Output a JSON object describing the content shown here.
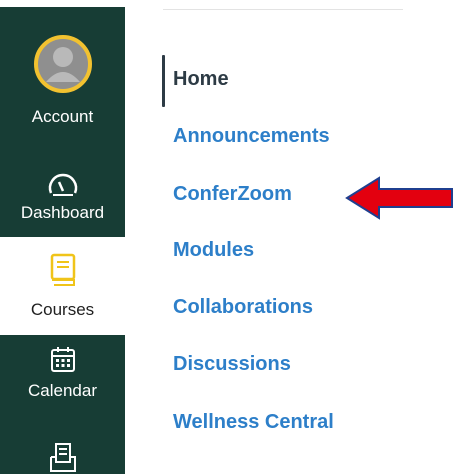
{
  "global_nav": {
    "account": {
      "label": "Account",
      "icon": "avatar-icon"
    },
    "dashboard": {
      "label": "Dashboard",
      "icon": "speedometer-icon"
    },
    "courses": {
      "label": "Courses",
      "icon": "book-icon"
    },
    "calendar": {
      "label": "Calendar",
      "icon": "calendar-icon"
    },
    "inbox": {
      "icon": "inbox-icon"
    }
  },
  "course_nav": {
    "items": [
      {
        "label": "Home",
        "active": true
      },
      {
        "label": "Announcements"
      },
      {
        "label": "ConferZoom"
      },
      {
        "label": "Modules"
      },
      {
        "label": "Collaborations"
      },
      {
        "label": "Discussions"
      },
      {
        "label": "Wellness Central"
      }
    ]
  },
  "colors": {
    "nav_bg": "#173d35",
    "link": "#2d7fc9",
    "active_text": "#2d3b45",
    "arrow": "#e3000f",
    "account_ring": "#f2c230",
    "courses_icon": "#f0c419"
  }
}
